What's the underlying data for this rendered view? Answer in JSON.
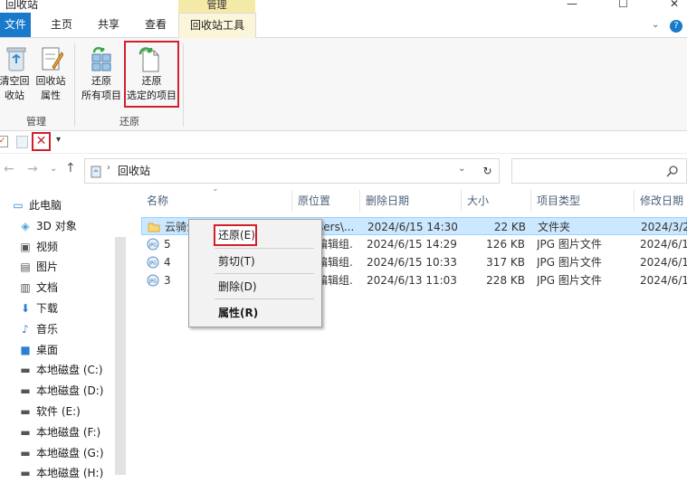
{
  "window": {
    "title": "回收站",
    "context_tab_group": "管理",
    "controls": {
      "minimize": "—",
      "maximize": "☐",
      "close": "✕"
    }
  },
  "tabs": [
    "文件",
    "主页",
    "共享",
    "查看",
    "回收站工具"
  ],
  "ribbon": {
    "groups": [
      {
        "label": "管理",
        "buttons": [
          {
            "line1": "清空回",
            "line2": "收站",
            "icon": "empty-recycle-bin-icon"
          },
          {
            "line1": "回收站",
            "line2": "属性",
            "icon": "recycle-bin-properties-icon"
          }
        ]
      },
      {
        "label": "还原",
        "buttons": [
          {
            "line1": "还原",
            "line2": "所有项目",
            "icon": "restore-all-icon"
          },
          {
            "line1": "还原",
            "line2": "选定的项目",
            "icon": "restore-selected-icon"
          }
        ]
      }
    ]
  },
  "addressbar": {
    "path": "回收站",
    "search_placeholder": ""
  },
  "nav_pane": [
    {
      "label": "此电脑",
      "icon": "this-pc-icon"
    },
    {
      "label": "3D 对象",
      "icon": "3d-objects-icon"
    },
    {
      "label": "视频",
      "icon": "videos-icon"
    },
    {
      "label": "图片",
      "icon": "pictures-icon"
    },
    {
      "label": "文档",
      "icon": "documents-icon"
    },
    {
      "label": "下载",
      "icon": "downloads-icon"
    },
    {
      "label": "音乐",
      "icon": "music-icon"
    },
    {
      "label": "桌面",
      "icon": "desktop-icon"
    },
    {
      "label": "本地磁盘 (C:)",
      "icon": "drive-icon"
    },
    {
      "label": "本地磁盘 (D:)",
      "icon": "drive-icon"
    },
    {
      "label": "软件 (E:)",
      "icon": "drive-icon"
    },
    {
      "label": "本地磁盘 (F:)",
      "icon": "drive-icon"
    },
    {
      "label": "本地磁盘 (G:)",
      "icon": "drive-icon"
    },
    {
      "label": "本地磁盘 (H:)",
      "icon": "drive-icon"
    }
  ],
  "columns": [
    "名称",
    "原位置",
    "删除日期",
    "大小",
    "项目类型",
    "修改日期"
  ],
  "files": [
    {
      "name": "云骑士",
      "location": "sers\\...",
      "deleted": "2024/6/15 14:30",
      "size": "22 KB",
      "type": "文件夹",
      "modified": "2024/3/2...",
      "icon": "folder-icon",
      "selected": true
    },
    {
      "name": "5",
      "location": "编辑组...",
      "deleted": "2024/6/15 14:29",
      "size": "126 KB",
      "type": "JPG 图片文件",
      "modified": "2024/6/1...",
      "icon": "jpg-file-icon",
      "selected": false
    },
    {
      "name": "4",
      "location": "编辑组...",
      "deleted": "2024/6/15 10:33",
      "size": "317 KB",
      "type": "JPG 图片文件",
      "modified": "2024/6/1...",
      "icon": "jpg-file-icon",
      "selected": false
    },
    {
      "name": "3",
      "location": "编辑组...",
      "deleted": "2024/6/13 11:03",
      "size": "228 KB",
      "type": "JPG 图片文件",
      "modified": "2024/6/1...",
      "icon": "jpg-file-icon",
      "selected": false
    }
  ],
  "context_menu": [
    "还原(E)",
    "剪切(T)",
    "删除(D)",
    "属性(R)"
  ],
  "colors": {
    "accent": "#1979ca",
    "highlight": "#d0202a",
    "selected_row": "#cce8ff",
    "context_tab": "#f5e9a8"
  }
}
